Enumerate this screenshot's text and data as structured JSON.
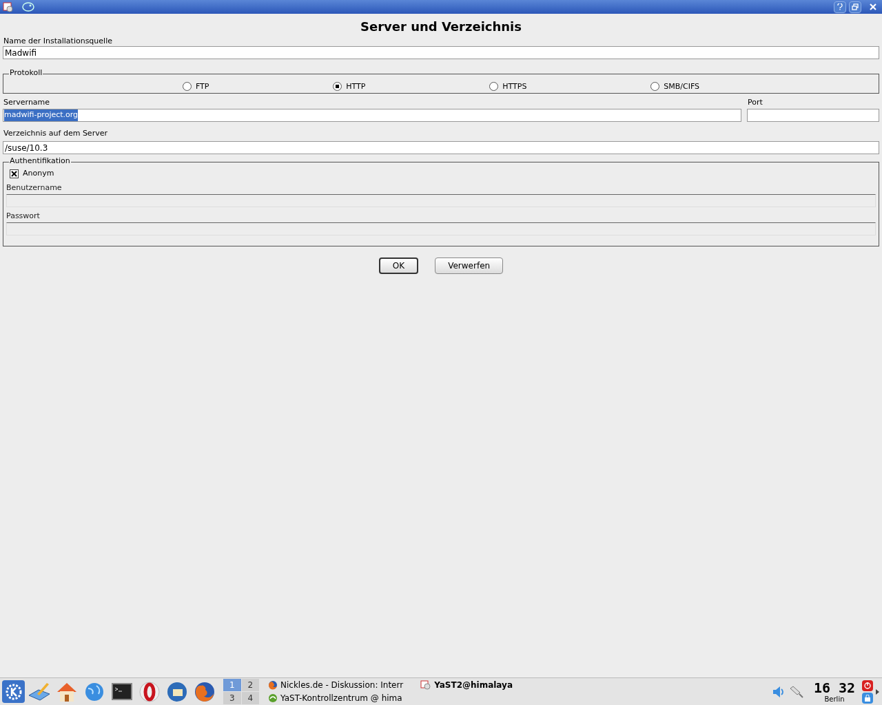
{
  "window": {
    "heading": "Server und Verzeichnis"
  },
  "source_name": {
    "label": "Name der Installationsquelle",
    "value": "Madwifi"
  },
  "protocol": {
    "legend": "Protokoll",
    "options": [
      {
        "label": "FTP",
        "selected": false
      },
      {
        "label": "HTTP",
        "selected": true
      },
      {
        "label": "HTTPS",
        "selected": false
      },
      {
        "label": "SMB/CIFS",
        "selected": false
      }
    ]
  },
  "server": {
    "label": "Servername",
    "value": "madwifi-project.org",
    "port_label": "Port"
  },
  "directory": {
    "label": "Verzeichnis auf dem Server",
    "value": "/suse/10.3"
  },
  "auth": {
    "legend": "Authentifikation",
    "anonymous": {
      "label": "Anonym",
      "checked": true
    },
    "fields": [
      {
        "label": "Benutzername",
        "disabled": true
      },
      {
        "label": "Passwort",
        "disabled": true
      }
    ]
  },
  "buttons": [
    {
      "label": "OK",
      "focused": true
    },
    {
      "label": "Verwerfen",
      "focused": false
    }
  ],
  "taskbar": {
    "desktops": [
      {
        "label": "1",
        "selected": true
      },
      {
        "label": "2",
        "selected": false
      },
      {
        "label": "3",
        "selected": false
      },
      {
        "label": "4",
        "selected": false
      }
    ],
    "tasks": [
      {
        "label": "Nickles.de - Diskussion: Interr",
        "active": false,
        "kind": "browser"
      },
      {
        "label": "YaST-Kontrollzentrum @ hima",
        "active": false,
        "kind": "yast"
      },
      {
        "label": "YaST2@himalaya",
        "active": true,
        "kind": "app"
      }
    ],
    "clock": {
      "time": "16 32",
      "zone": "Berlin"
    }
  }
}
